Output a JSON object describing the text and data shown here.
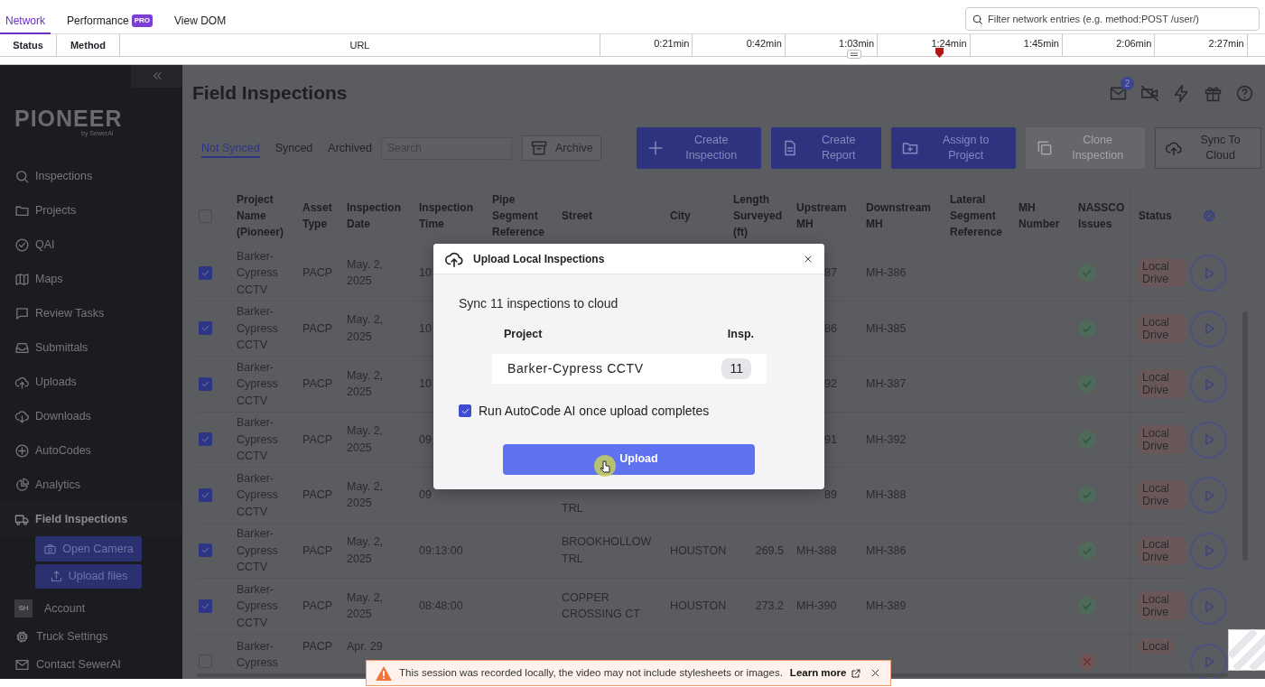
{
  "devtools": {
    "tabs": [
      {
        "label": "Network",
        "selected": true
      },
      {
        "label": "Performance",
        "badge": "PRO",
        "selected": false
      },
      {
        "label": "View DOM",
        "selected": false
      }
    ],
    "filter": {
      "placeholder": "Filter network entries (e.g. method:POST /user/)"
    },
    "columns": [
      "Status",
      "Method",
      "URL"
    ],
    "timeline_ticks": [
      "0:21min",
      "0:42min",
      "1:03min",
      "1:24min",
      "1:45min",
      "2:06min",
      "2:27min"
    ]
  },
  "sidebar": {
    "logo": "PIONEER",
    "tagline": "by SewerAI",
    "items": [
      {
        "label": "Inspections",
        "selected": false
      },
      {
        "label": "Projects",
        "selected": false
      },
      {
        "label": "QAI",
        "selected": false
      },
      {
        "label": "Maps",
        "selected": false
      },
      {
        "label": "Review Tasks",
        "selected": false
      },
      {
        "label": "Submittals",
        "selected": false
      },
      {
        "label": "Uploads",
        "selected": false
      },
      {
        "label": "Downloads",
        "selected": false
      },
      {
        "label": "AutoCodes",
        "selected": false
      },
      {
        "label": "Analytics",
        "selected": false
      },
      {
        "label": "Field Inspections",
        "selected": true
      }
    ],
    "sub_actions": [
      "Open Camera",
      "Upload files"
    ],
    "account": {
      "initials": "SH",
      "label": "Account"
    },
    "footer_items": [
      "Truck Settings",
      "Contact SewerAI"
    ]
  },
  "page": {
    "title": "Field Inspections",
    "notification_count": "2"
  },
  "filters": {
    "tabs": [
      {
        "label": "Not Synced",
        "selected": true
      },
      {
        "label": "Synced",
        "selected": false
      },
      {
        "label": "Archived",
        "selected": false
      }
    ],
    "search": {
      "placeholder": "Search"
    },
    "archive": "Archive"
  },
  "actions": [
    {
      "label": "Create Inspection",
      "kind": "primary"
    },
    {
      "label": "Create Report",
      "kind": "primary"
    },
    {
      "label": "Assign to Project",
      "kind": "primary"
    },
    {
      "label": "Clone Inspection",
      "kind": "disabled"
    },
    {
      "label": "Sync To Cloud",
      "kind": "outline"
    }
  ],
  "table": {
    "select_all_checked": false,
    "columns": [
      "Project Name (Pioneer)",
      "Asset Type",
      "Inspection Date",
      "Inspection Time",
      "Pipe Segment Reference",
      "Street",
      "City",
      "Length Surveyed (ft)",
      "Upstream MH",
      "Downstream MH",
      "Lateral Segment Reference",
      "MH Number",
      "NASSCO Issues",
      "Status"
    ],
    "rows": [
      {
        "checked": true,
        "project": "Barker-Cypress CCTV",
        "asset_type": "PACP",
        "date": "May. 2, 2025",
        "time": "10",
        "upstream_mh": "87",
        "downstream_mh": "MH-386",
        "nassco_ok": true,
        "status": "Local Drive"
      },
      {
        "checked": true,
        "project": "Barker-Cypress CCTV",
        "asset_type": "PACP",
        "date": "May. 2, 2025",
        "time": "10",
        "upstream_mh": "86",
        "downstream_mh": "MH-385",
        "nassco_ok": true,
        "status": "Local Drive"
      },
      {
        "checked": true,
        "project": "Barker-Cypress CCTV",
        "asset_type": "PACP",
        "date": "May. 2, 2025",
        "time": "10",
        "upstream_mh": "92",
        "downstream_mh": "MH-387",
        "nassco_ok": true,
        "status": "Local Drive"
      },
      {
        "checked": true,
        "project": "Barker-Cypress CCTV",
        "asset_type": "PACP",
        "date": "May. 2, 2025",
        "time": "09",
        "upstream_mh": "91",
        "downstream_mh": "MH-392",
        "nassco_ok": true,
        "status": "Local Drive"
      },
      {
        "checked": true,
        "project": "Barker-Cypress CCTV",
        "asset_type": "PACP",
        "date": "May. 2, 2025",
        "time": "09",
        "street": "TRL",
        "upstream_mh": "89",
        "downstream_mh": "MH-388",
        "nassco_ok": true,
        "status": "Local Drive"
      },
      {
        "checked": true,
        "project": "Barker-Cypress CCTV",
        "asset_type": "PACP",
        "date": "May. 2, 2025",
        "time": "09:13:00",
        "street": "BROOKHOLLOW TRL",
        "city": "HOUSTON",
        "length": "269.5",
        "upstream_mh": "MH-388",
        "downstream_mh": "MH-386",
        "nassco_ok": true,
        "status": "Local Drive"
      },
      {
        "checked": true,
        "project": "Barker-Cypress CCTV",
        "asset_type": "PACP",
        "date": "May. 2, 2025",
        "time": "08:48:00",
        "street": "COPPER CROSSING CT",
        "city": "HOUSTON",
        "length": "273.2",
        "upstream_mh": "MH-390",
        "downstream_mh": "MH-389",
        "nassco_ok": true,
        "status": "Local Drive"
      },
      {
        "checked": false,
        "project": "Barker-Cypress",
        "asset_type": "PACP",
        "date": "Apr. 29",
        "nassco_ok": false,
        "status": "Local"
      }
    ]
  },
  "modal": {
    "title": "Upload Local Inspections",
    "summary": "Sync 11 inspections to cloud",
    "columns": [
      "Project",
      "Insp."
    ],
    "rows": [
      {
        "project": "Barker-Cypress CCTV",
        "count": "11"
      }
    ],
    "autocode": {
      "label": "Run AutoCode AI once upload completes",
      "checked": true
    },
    "button": "Upload"
  },
  "toast": {
    "message": "This session was recorded locally, the video may not include stylesheets or images.",
    "link": "Learn more"
  }
}
